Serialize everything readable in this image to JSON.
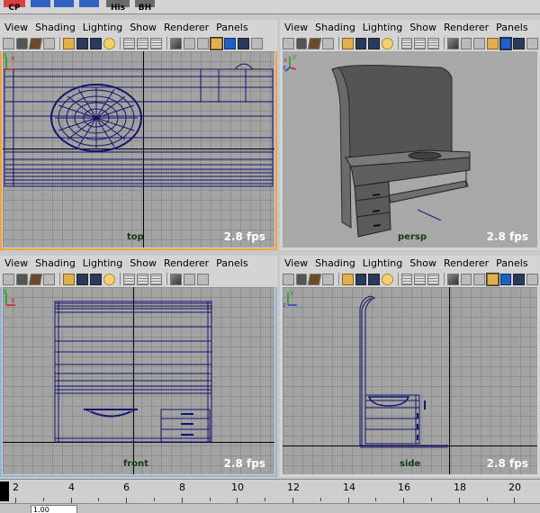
{
  "shelf": [
    {
      "label": "CP",
      "icon": "cp-shelf-icon"
    },
    {
      "label": "",
      "icon": "blue-shelf-icon-1"
    },
    {
      "label": "",
      "icon": "blue-shelf-icon-2"
    },
    {
      "label": "",
      "icon": "blue-shelf-icon-3"
    },
    {
      "label": "His",
      "icon": "history-shelf-icon"
    },
    {
      "label": "BH",
      "icon": "bh-shelf-icon"
    }
  ],
  "menu": [
    "View",
    "Shading",
    "Lighting",
    "Show",
    "Renderer",
    "Panels"
  ],
  "panels": {
    "top": {
      "camera": "top",
      "fps": "2.8 fps"
    },
    "persp": {
      "camera": "persp",
      "fps": "2.8 fps"
    },
    "front": {
      "camera": "front",
      "fps": "2.8 fps"
    },
    "side": {
      "camera": "side",
      "fps": "2.8 fps"
    }
  },
  "gizmo": {
    "x": "x",
    "y": "y",
    "z": "z"
  },
  "timeline": {
    "ticks": [
      "2",
      "4",
      "6",
      "8",
      "10",
      "12",
      "14",
      "16",
      "18",
      "20"
    ],
    "current_frame": "1.00"
  },
  "colors": {
    "wire": "#14146e",
    "active_outline": "#f0a040",
    "grid": "#a3a3a3"
  }
}
